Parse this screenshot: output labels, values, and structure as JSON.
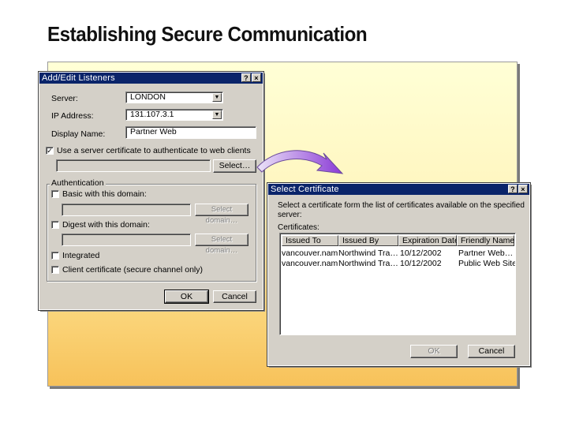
{
  "slide": {
    "title": "Establishing Secure Communication"
  },
  "listeners_dialog": {
    "title": "Add/Edit Listeners",
    "help_glyph": "?",
    "close_glyph": "×",
    "server_label": "Server:",
    "server_value": "LONDON",
    "ip_label": "IP Address:",
    "ip_value": "131.107.3.1",
    "display_name_label": "Display Name:",
    "display_name_value": "Partner Web",
    "use_cert_label": "Use a server certificate to authenticate to web clients",
    "use_cert_checked": "✓",
    "select_button": "Select…",
    "auth_group_label": "Authentication",
    "basic_label": "Basic with this domain:",
    "basic_select_button": "Select domain…",
    "digest_label": "Digest with this domain:",
    "digest_select_button": "Select domain…",
    "integrated_label": "Integrated",
    "client_cert_label": "Client certificate (secure channel only)",
    "ok_button": "OK",
    "cancel_button": "Cancel"
  },
  "cert_dialog": {
    "title": "Select Certificate",
    "help_glyph": "?",
    "close_glyph": "×",
    "instructions_line1": "Select a certificate form the list of certificates available on the specified",
    "instructions_line2": "server:",
    "certs_label": "Certificates:",
    "columns": [
      "Issued To",
      "Issued By",
      "Expiration Date",
      "Friendly Name"
    ],
    "rows": [
      [
        "vancouver.nam…",
        "Northwind Tra…",
        "10/12/2002",
        "Partner Web…"
      ],
      [
        "vancouver.nam…",
        "Northwind Tra…",
        "10/12/2002",
        "Public Web Site"
      ]
    ],
    "ok_button": "OK",
    "cancel_button": "Cancel"
  },
  "colors": {
    "titlebar": "#0a246a",
    "dialog_face": "#d4d0c8",
    "arrow_start": "#d8c8f0",
    "arrow_end": "#8a3ad6"
  },
  "icons": [
    "dropdown-arrow-icon",
    "help-icon",
    "close-icon",
    "checkmark-icon",
    "curved-arrow-icon"
  ]
}
